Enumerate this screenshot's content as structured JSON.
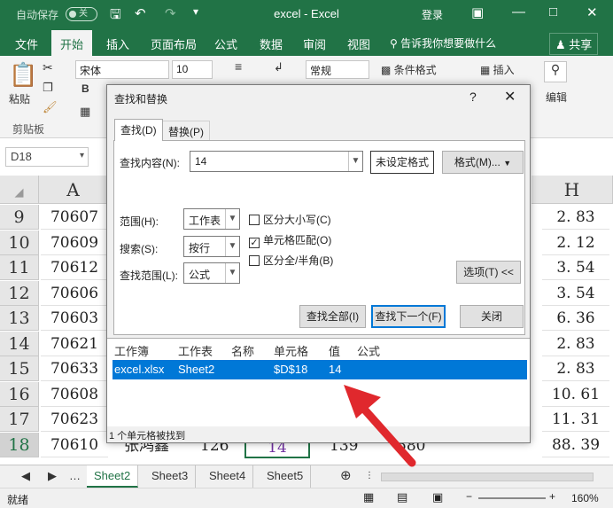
{
  "titlebar": {
    "autosave": "自动保存",
    "toggle": "关",
    "title": "excel  -  Excel",
    "login": "登录"
  },
  "ribbon_tabs": [
    "文件",
    "开始",
    "插入",
    "页面布局",
    "公式",
    "数据",
    "审阅",
    "视图"
  ],
  "active_tab": "开始",
  "tellme": "告诉我你想要做什么",
  "share": "共享",
  "ribbon": {
    "paste": "粘贴",
    "font_name": "宋体",
    "font_size": "10",
    "number_format": "常规",
    "conditional_format": "条件格式",
    "insert": "插入",
    "edit": "编辑",
    "clipboard": "剪贴板"
  },
  "namebox": "D18",
  "columns": {
    "first": "A",
    "last": "H"
  },
  "rows": [
    {
      "num": "9",
      "a": "70607",
      "h": "2. 83"
    },
    {
      "num": "10",
      "a": "70609",
      "h": "2. 12"
    },
    {
      "num": "11",
      "a": "70612",
      "h": "3. 54"
    },
    {
      "num": "12",
      "a": "70606",
      "h": "3. 54"
    },
    {
      "num": "13",
      "a": "70603",
      "h": "6. 36"
    },
    {
      "num": "14",
      "a": "70621",
      "h": "2. 83"
    },
    {
      "num": "15",
      "a": "70633",
      "h": "2. 83"
    },
    {
      "num": "16",
      "a": "70608",
      "h": "10. 61"
    },
    {
      "num": "17",
      "a": "70623",
      "h": "11. 31"
    },
    {
      "num": "18",
      "a": "70610",
      "h": "88. 39"
    }
  ],
  "row18_extra": {
    "b": "张鸿鑫",
    "c": "126",
    "d": "14",
    "e": "139",
    "f": "580"
  },
  "sheets": [
    "Sheet2",
    "Sheet3",
    "Sheet4",
    "Sheet5"
  ],
  "active_sheet": "Sheet2",
  "status": {
    "ready": "就绪",
    "zoom": "160%"
  },
  "dialog": {
    "title": "查找和替换",
    "help": "?",
    "tabs": [
      "查找(D)",
      "替换(P)"
    ],
    "find_label": "查找内容(N):",
    "find_value": "14",
    "no_format": "未设定格式",
    "format_btn": "格式(M)...",
    "within_label": "范围(H):",
    "within_value": "工作表",
    "search_label": "搜索(S):",
    "search_value": "按行",
    "lookin_label": "查找范围(L):",
    "lookin_value": "公式",
    "match_case": "区分大小写(C)",
    "match_case_checked": false,
    "match_entire": "单元格匹配(O)",
    "match_entire_checked": true,
    "match_width": "区分全/半角(B)",
    "match_width_checked": false,
    "options_btn": "选项(T) <<",
    "find_all": "查找全部(I)",
    "find_next": "查找下一个(F)",
    "close": "关闭",
    "result_headers": [
      "工作簿",
      "工作表",
      "名称",
      "单元格",
      "值",
      "公式"
    ],
    "result_row": [
      "excel.xlsx",
      "Sheet2",
      "",
      "$D$18",
      "14",
      ""
    ],
    "status": "1 个单元格被找到"
  },
  "colors": {
    "excel_green": "#217346",
    "selection_blue": "#0078d7",
    "arrow_red": "#e0282d"
  }
}
